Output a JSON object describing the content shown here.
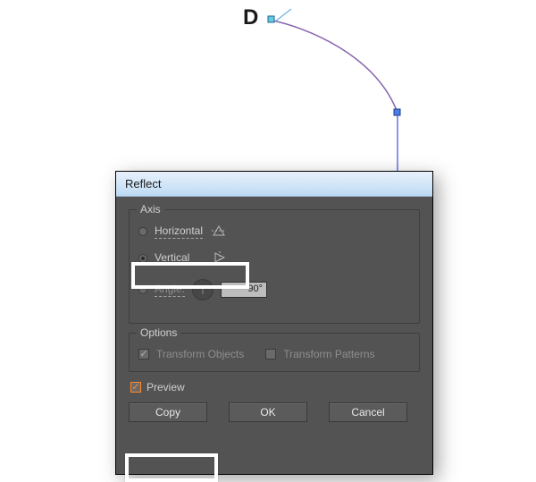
{
  "canvas": {
    "letter": "D"
  },
  "dialog": {
    "title": "Reflect",
    "axis": {
      "group_label": "Axis",
      "horizontal_label": "Horizontal",
      "vertical_label": "Vertical",
      "angle_label": "Angle:",
      "angle_value": "90°",
      "selected": "vertical"
    },
    "options": {
      "group_label": "Options",
      "transform_objects_label": "Transform Objects",
      "transform_patterns_label": "Transform Patterns",
      "transform_objects_checked": true,
      "transform_patterns_checked": false
    },
    "preview": {
      "label": "Preview",
      "checked": true
    },
    "buttons": {
      "copy": "Copy",
      "ok": "OK",
      "cancel": "Cancel"
    }
  }
}
